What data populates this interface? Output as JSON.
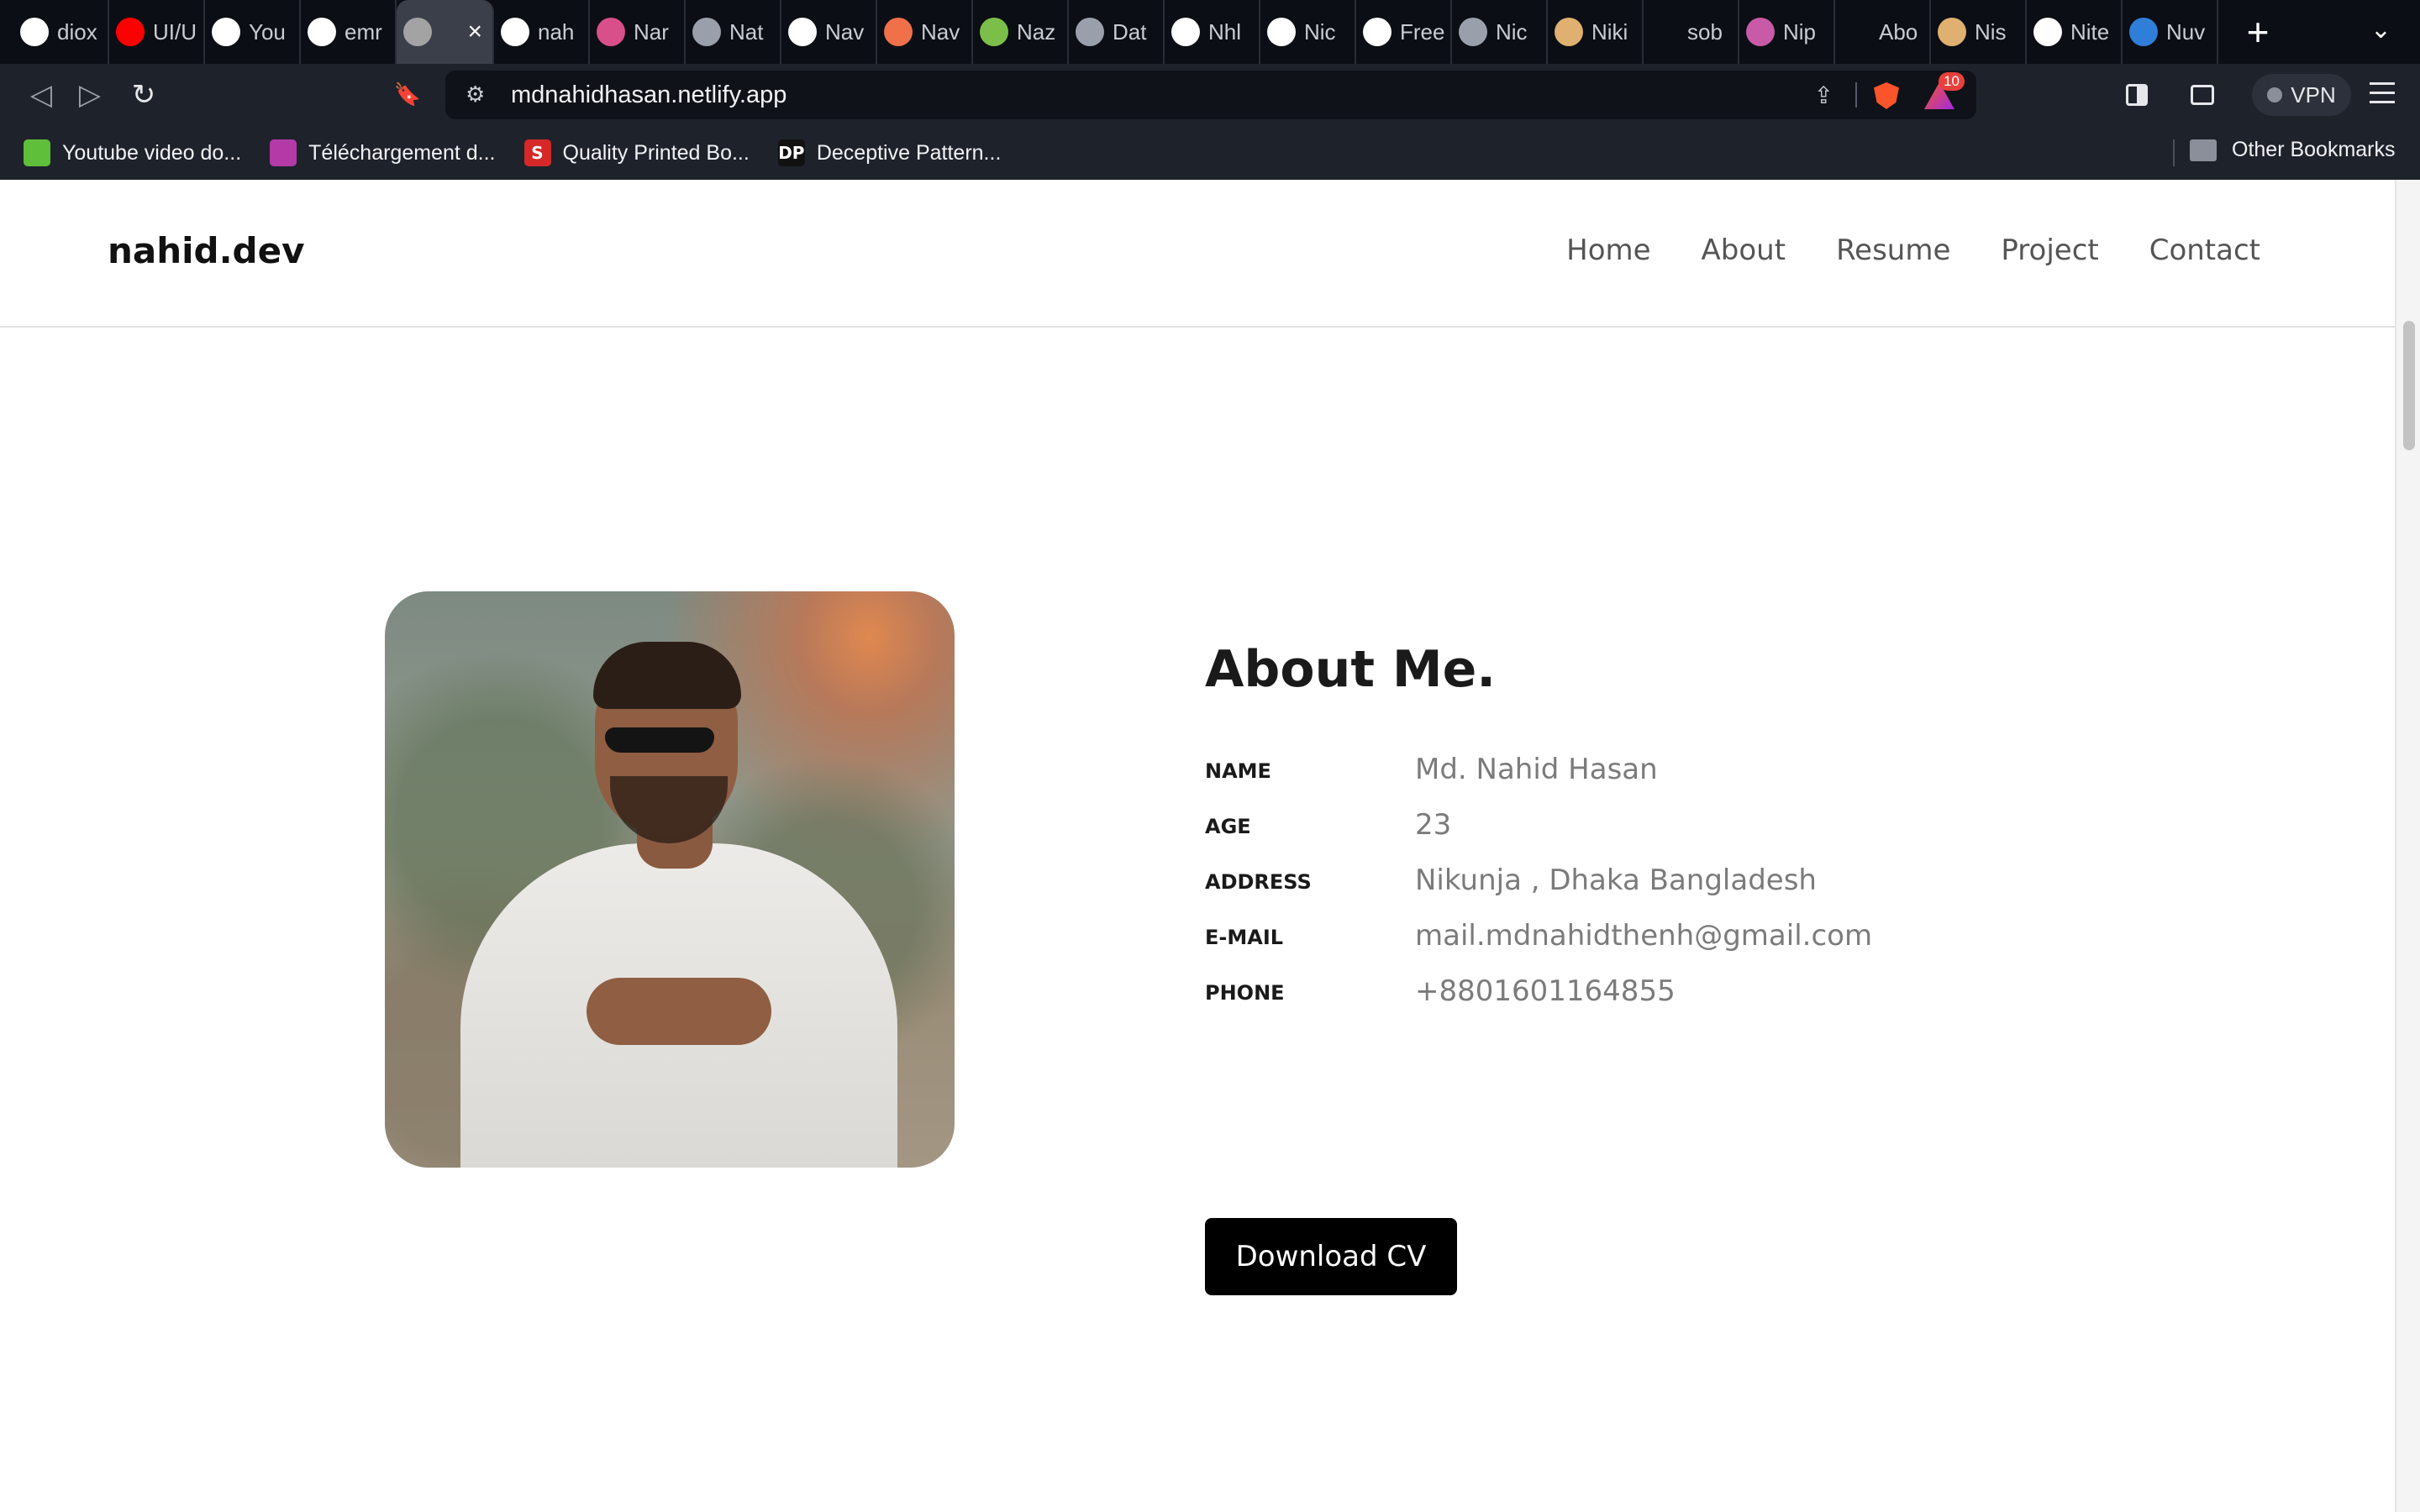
{
  "browser": {
    "tabs": [
      {
        "icon": "google-icon",
        "title": "diox",
        "color": "#ffffff"
      },
      {
        "icon": "youtube-icon",
        "title": "UI/U",
        "color": "#ff0000"
      },
      {
        "icon": "github-icon",
        "title": "You",
        "color": "#ffffff"
      },
      {
        "icon": "github-icon",
        "title": "emr",
        "color": "#ffffff"
      },
      {
        "icon": "avatar-icon",
        "title": "",
        "color": "#a3a3a3",
        "active": true
      },
      {
        "icon": "github-icon",
        "title": "nah",
        "color": "#ffffff"
      },
      {
        "icon": "gradient-icon",
        "title": "Nar",
        "color": "#d94f8a"
      },
      {
        "icon": "globe-icon",
        "title": "Nat",
        "color": "#9aa0ab"
      },
      {
        "icon": "wordpress-icon",
        "title": "Nav",
        "color": "#ffffff"
      },
      {
        "icon": "face-icon",
        "title": "Nav",
        "color": "#f0704a"
      },
      {
        "icon": "cartoon-icon",
        "title": "Naz",
        "color": "#7bbf4a"
      },
      {
        "icon": "globe-icon",
        "title": "Dat",
        "color": "#9aa0ab"
      },
      {
        "icon": "notion-icon",
        "title": "Nhl",
        "color": "#ffffff"
      },
      {
        "icon": "link-icon",
        "title": "Nic",
        "color": "#ffffff"
      },
      {
        "icon": "id-icon",
        "title": "Free",
        "color": "#ffffff"
      },
      {
        "icon": "globe-icon",
        "title": "Nic",
        "color": "#9aa0ab"
      },
      {
        "icon": "person-icon",
        "title": "Niki",
        "color": "#e0b070"
      },
      {
        "icon": "terminal-icon",
        "title": "sob",
        "color": "#0b0e14"
      },
      {
        "icon": "photo-icon",
        "title": "Nip",
        "color": "#c85aa8"
      },
      {
        "icon": "blank-icon",
        "title": "Abo",
        "color": "#0b0e14"
      },
      {
        "icon": "person-icon",
        "title": "Nis",
        "color": "#e0b070"
      },
      {
        "icon": "bars-icon",
        "title": "Nite",
        "color": "#ffffff"
      },
      {
        "icon": "nj-icon",
        "title": "Nuv",
        "color": "#2f7fd8"
      }
    ],
    "active_close_label": "×",
    "new_tab_label": "+",
    "tab_menu_label": "⌄",
    "back_label": "◁",
    "forward_label": "▷",
    "reload_label": "↻",
    "bookmark_label": "🔖",
    "site_info_label": "⚙",
    "address": "mdnahidhasan.netlify.app",
    "share_label": "⇪",
    "rewards_count": "10",
    "vpn_label": "VPN",
    "bookmarks": [
      {
        "icon": "download-arrow-icon",
        "label": "Youtube video do...",
        "color": "#5fbf3a"
      },
      {
        "icon": "media-icon",
        "label": "Téléchargement d...",
        "color": "#b43aa8"
      },
      {
        "icon": "s-logo-icon",
        "label": "Quality Printed Bo...",
        "color": "#d62828",
        "glyph": "S"
      },
      {
        "icon": "dp-logo-icon",
        "label": "Deceptive Pattern...",
        "color": "#111111",
        "glyph": "DP"
      }
    ],
    "other_bookmarks_label": "Other Bookmarks"
  },
  "site": {
    "logo": "nahid.dev",
    "nav": [
      "Home",
      "About",
      "Resume",
      "Project",
      "Contact"
    ]
  },
  "about": {
    "title": "About Me.",
    "fields": [
      {
        "key": "NAME",
        "value": "Md. Nahid Hasan"
      },
      {
        "key": "AGE",
        "value": "23"
      },
      {
        "key": "ADDRESS",
        "value": "Nikunja , Dhaka Bangladesh"
      },
      {
        "key": "E-MAIL",
        "value": "mail.mdnahidthenh@gmail.com"
      },
      {
        "key": "PHONE",
        "value": "+8801601164855"
      }
    ],
    "button_label": "Download CV"
  }
}
